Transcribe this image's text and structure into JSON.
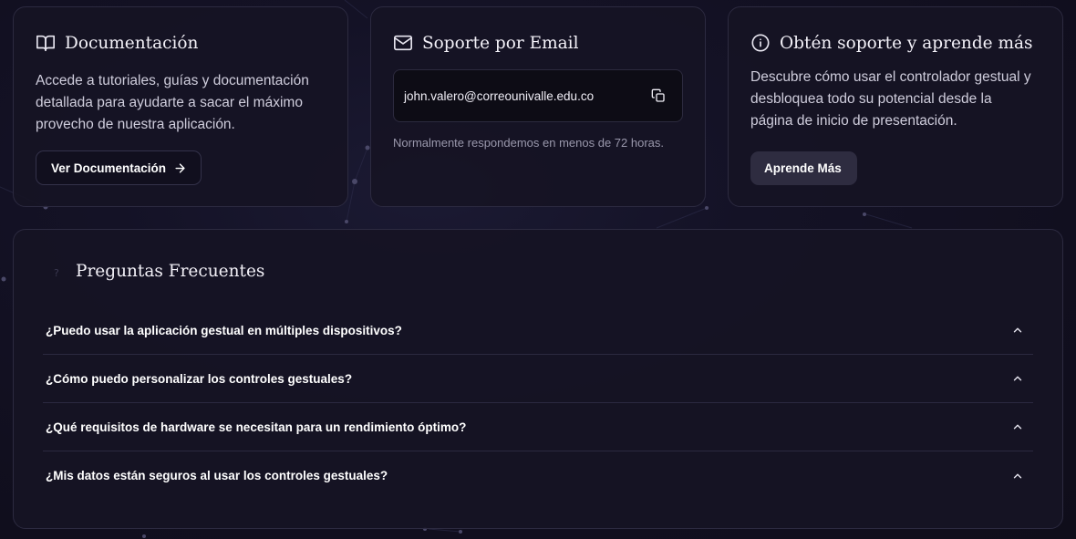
{
  "cards": {
    "docs": {
      "title": "Documentación",
      "body_lines": [
        "Accede a tutoriales, guías y documentación",
        "detallada para ayudarte a sacar el máximo",
        "provecho de nuestra aplicación."
      ],
      "button_label": "Ver Documentación",
      "icon": "book-open-icon"
    },
    "email": {
      "title": "Soporte por Email",
      "address": "john.valero@correounivalle.edu.co",
      "note": "Normalmente respondemos en menos de 72 horas.",
      "icon": "mail-icon",
      "copy_icon": "copy-icon"
    },
    "learn": {
      "title": "Obtén soporte y aprende más",
      "body_lines": [
        "Descubre cómo usar el controlador gestual y",
        "desbloquea todo su potencial desde la",
        "página de inicio de presentación."
      ],
      "button_label": "Aprende Más",
      "icon": "info-icon"
    }
  },
  "faq": {
    "title": "Preguntas Frecuentes",
    "icon": "question-icon",
    "items": [
      {
        "question": "¿Puedo usar la aplicación gestual en múltiples dispositivos?"
      },
      {
        "question": "¿Cómo puedo personalizar los controles gestuales?"
      },
      {
        "question": "¿Qué requisitos de hardware se necesitan para un rendimiento óptimo?"
      },
      {
        "question": "¿Mis datos están seguros al usar los controles gestuales?"
      }
    ]
  },
  "colors": {
    "background": "#110f1f",
    "card": "#16142a",
    "border": "#2c2a40",
    "text": "#f3f1f8",
    "muted": "#9a98ac"
  }
}
